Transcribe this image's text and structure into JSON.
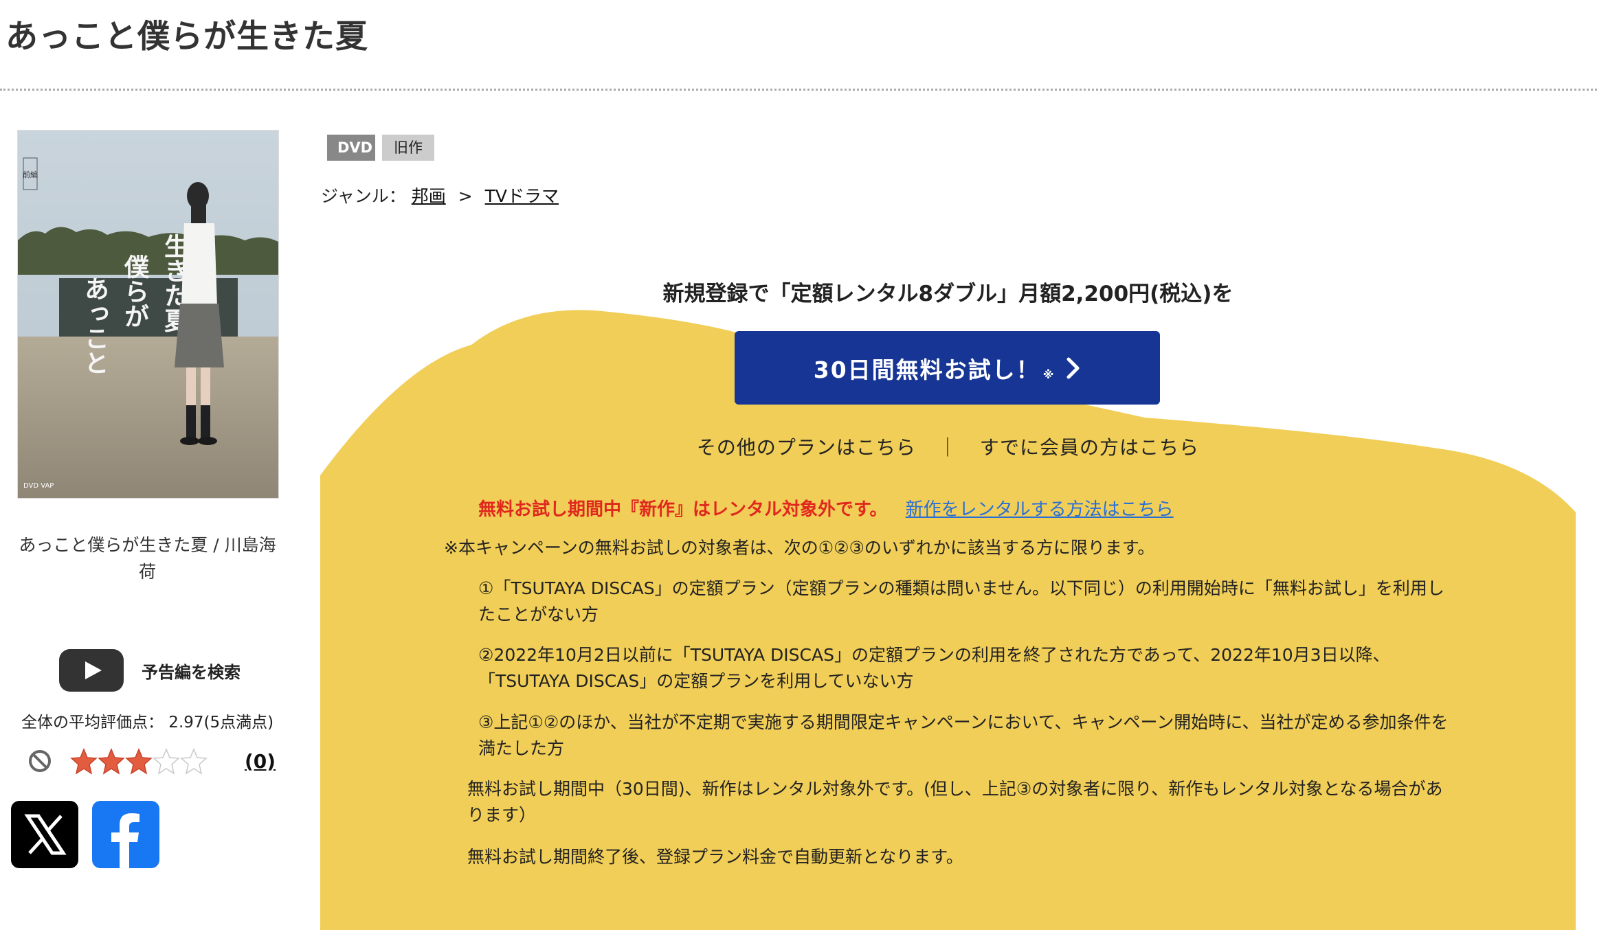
{
  "page_title": "あっこと僕らが生きた夏",
  "poster": {
    "title_vertical": [
      "あっこと",
      "僕らが",
      "生きた夏"
    ],
    "badge_top": "前編",
    "brand": "DVD VAP"
  },
  "poster_caption": "あっこと僕らが生きた夏 / 川島海荷",
  "trailer": {
    "label": "予告編を検索",
    "icon": "play-icon"
  },
  "rating": {
    "average_text": "全体の平均評価点： 2.97(5点満点)",
    "stars_filled": 3,
    "stars_total": 5,
    "review_count": "(0)"
  },
  "social": {
    "x": "x-icon",
    "facebook": "facebook-icon"
  },
  "tags": {
    "format": "DVD",
    "status": "旧作"
  },
  "genre": {
    "label": "ジャンル：",
    "parent": "邦画",
    "separator": ">",
    "child": "TVドラマ"
  },
  "promo": {
    "heading": "新規登録で「定額レンタル8ダブル」月額2,200円(税込)を",
    "button_label": "30日間無料お試し！",
    "button_note": "※",
    "other_plans": "その他のプランはこちら",
    "link_separator": "｜",
    "member_link": "すでに会員の方はこちら",
    "warning_red": "無料お試し期間中『新作』はレンタル対象外です。",
    "warning_link": "新作をレンタルする方法はこちら",
    "campaign_intro": "※本キャンペーンの無料お試しの対象者は、次の①②③のいずれかに該当する方に限ります。",
    "conditions": [
      "①「TSUTAYA DISCAS」の定額プラン（定額プランの種類は問いません。以下同じ）の利用開始時に「無料お試し」を利用したことがない方",
      "②2022年10月2日以前に「TSUTAYA DISCAS」の定額プランの利用を終了された方であって、2022年10月3日以降、「TSUTAYA DISCAS」の定額プランを利用していない方",
      "③上記①②のほか、当社が不定期で実施する期間限定キャンペーンにおいて、キャンペーン開始時に、当社が定める参加条件を満たした方"
    ],
    "note_1": "無料お試し期間中（30日間)、新作はレンタル対象外です。(但し、上記③の対象者に限り、新作もレンタル対象となる場合があります）",
    "note_2": "無料お試し期間終了後、登録プラン料金で自動更新となります。"
  },
  "colors": {
    "promo_yellow": "#f1ce57",
    "button_blue": "#163594",
    "warning_red": "#e0281e",
    "link_blue": "#2a6fd6"
  }
}
